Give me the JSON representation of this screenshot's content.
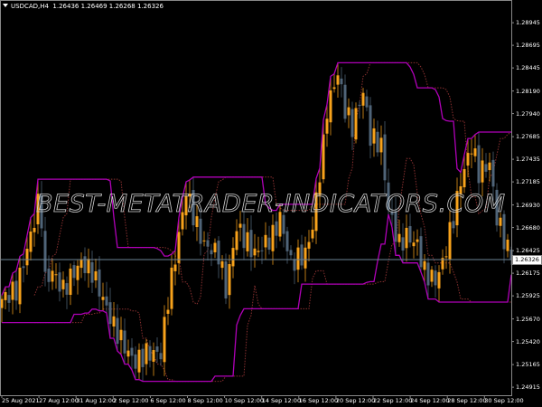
{
  "header": {
    "symbol": "USDCAD,H4",
    "open": "1.26436",
    "high": "1.26469",
    "low": "1.26268",
    "close": "1.26326"
  },
  "watermark": "BEST-METATRADER-INDICATORS.COM",
  "colors": {
    "up": "#f7a21b",
    "down": "#4f6478",
    "channel": "#b000b8",
    "channel_dotted": "#8a3030",
    "price_line": "#6d8396",
    "axis": "#888888"
  },
  "chart_data": {
    "type": "candlestick",
    "symbol": "USDCAD",
    "timeframe": "H4",
    "ylim": [
      1.2478,
      1.2915
    ],
    "y_ticks": [
      "1.28945",
      "1.28695",
      "1.28445",
      "1.28190",
      "1.27940",
      "1.27685",
      "1.27435",
      "1.27185",
      "1.26930",
      "1.26680",
      "1.26425",
      "1.26175",
      "1.25925",
      "1.25670",
      "1.25420",
      "1.25165",
      "1.24915"
    ],
    "x_ticks": [
      "25 Aug 2021",
      "27 Aug 12:00",
      "31 Aug 12:00",
      "2 Sep 12:00",
      "6 Sep 12:00",
      "8 Sep 12:00",
      "10 Sep 12:00",
      "14 Sep 12:00",
      "16 Sep 12:00",
      "20 Sep 12:00",
      "22 Sep 12:00",
      "24 Sep 12:00",
      "28 Sep 12:00",
      "30 Sep 12:00"
    ],
    "current_price": "1.26326",
    "close_waypoints": [
      [
        0,
        1.2589
      ],
      [
        4,
        1.2599
      ],
      [
        8,
        1.2659
      ],
      [
        10,
        1.2694
      ],
      [
        11,
        1.2679
      ],
      [
        12,
        1.2609
      ],
      [
        14,
        1.2619
      ],
      [
        17,
        1.2599
      ],
      [
        20,
        1.2619
      ],
      [
        22,
        1.2629
      ],
      [
        25,
        1.2619
      ],
      [
        28,
        1.2589
      ],
      [
        31,
        1.2559
      ],
      [
        35,
        1.2529
      ],
      [
        37,
        1.2519
      ],
      [
        40,
        1.2529
      ],
      [
        44,
        1.2529
      ],
      [
        46,
        1.2589
      ],
      [
        49,
        1.2659
      ],
      [
        51,
        1.2709
      ],
      [
        54,
        1.2669
      ],
      [
        56,
        1.2649
      ],
      [
        60,
        1.2639
      ],
      [
        62,
        1.2599
      ],
      [
        65,
        1.2669
      ],
      [
        70,
        1.2639
      ],
      [
        75,
        1.2659
      ],
      [
        77,
        1.2679
      ],
      [
        80,
        1.2629
      ],
      [
        84,
        1.2639
      ],
      [
        86,
        1.2669
      ],
      [
        89,
        1.2759
      ],
      [
        90,
        1.2799
      ],
      [
        93,
        1.2839
      ],
      [
        95,
        1.2799
      ],
      [
        97,
        1.2779
      ],
      [
        100,
        1.2819
      ],
      [
        102,
        1.2769
      ],
      [
        105,
        1.2759
      ],
      [
        107,
        1.2689
      ],
      [
        110,
        1.2649
      ],
      [
        112,
        1.2659
      ],
      [
        115,
        1.2649
      ],
      [
        117,
        1.2619
      ],
      [
        120,
        1.2609
      ],
      [
        122,
        1.2629
      ],
      [
        125,
        1.2679
      ],
      [
        127,
        1.2719
      ],
      [
        130,
        1.2759
      ],
      [
        132,
        1.2729
      ],
      [
        135,
        1.2739
      ],
      [
        137,
        1.2679
      ],
      [
        141,
        1.2633
      ]
    ],
    "indicator": "price channel (solid) and shifted channel (dotted)"
  }
}
